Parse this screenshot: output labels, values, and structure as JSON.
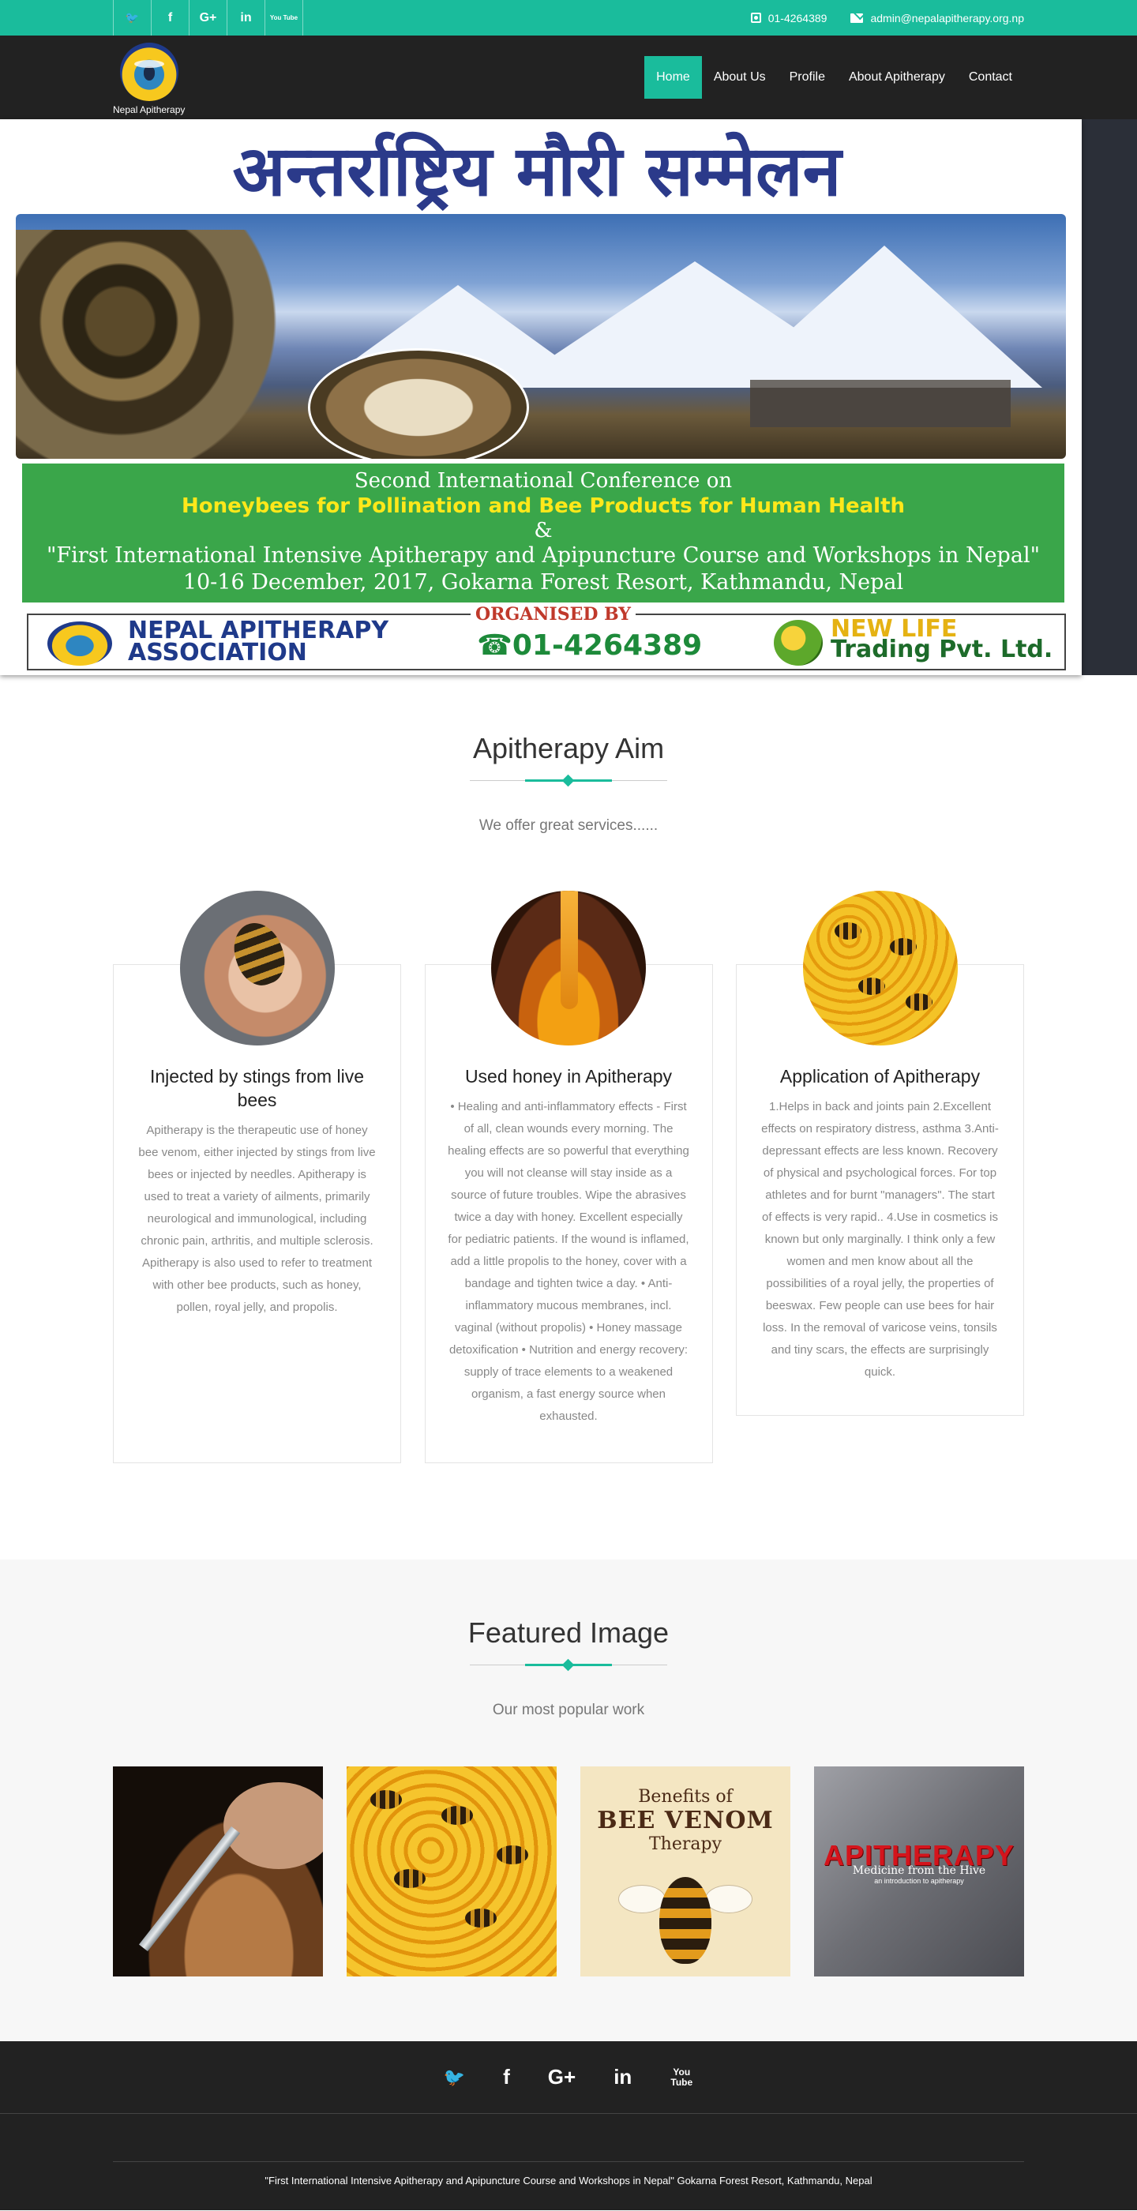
{
  "topbar": {
    "social": [
      {
        "icon": "twitter-icon",
        "glyph": "🐦"
      },
      {
        "icon": "facebook-icon",
        "glyph": "f"
      },
      {
        "icon": "google-plus-icon",
        "glyph": "G+"
      },
      {
        "icon": "linkedin-icon",
        "glyph": "in"
      },
      {
        "icon": "youtube-icon",
        "glyph": "You Tube"
      }
    ],
    "phone": "01-4264389",
    "email": "admin@nepalapitherapy.org.np"
  },
  "nav": {
    "brand": "Nepal Apitherapy",
    "items": [
      "Home",
      "About Us",
      "Profile",
      "About Apitherapy",
      "Contact"
    ],
    "active": "Home"
  },
  "banner": {
    "title": "अन्तर्राष्ट्रिय मौरी सम्मेलन",
    "line1": "Second International Conference on",
    "line2": "Honeybees for Pollination and Bee Products for Human Health",
    "line3": "&",
    "line4": "\"First International Intensive Apitherapy and Apipuncture Course and Workshops in Nepal\"",
    "line5": "10-16 December, 2017, Gokarna Forest Resort, Kathmandu, Nepal",
    "organised_by": "ORGANISED BY",
    "org_name_1": "NEPAL APITHERAPY",
    "org_name_2": "ASSOCIATION",
    "org_phone": "☎01-4264389",
    "partner_1": "NEW LIFE",
    "partner_2": "Trading Pvt. Ltd.",
    "partner_logo_text": "NEW LIFE"
  },
  "aim": {
    "title": "Apitherapy Aim",
    "subtitle": "We offer great services......",
    "cards": [
      {
        "title": "Injected by stings from live bees",
        "text": "Apitherapy is the therapeutic use of honey bee venom, either injected by stings from live bees or injected by needles. Apitherapy is used to treat a variety of ailments, primarily neurological and immunological, including chronic pain, arthritis, and multiple sclerosis. Apitherapy is also used to refer to treatment with other bee products, such as honey, pollen, royal jelly, and propolis."
      },
      {
        "title": "Used honey in Apitherapy",
        "text": "• Healing and anti-inflammatory effects - First of all, clean wounds every morning. The healing effects are so powerful that everything you will not cleanse will stay inside as a source of future troubles. Wipe the abrasives twice a day with honey. Excellent especially for pediatric patients. If the wound is inflamed, add a little propolis to the honey, cover with a bandage and tighten twice a day. • Anti-inflammatory mucous membranes, incl. vaginal (without propolis) • Honey massage detoxification • Nutrition and energy recovery: supply of trace elements to a weakened organism, a fast energy source when exhausted."
      },
      {
        "title": "Application of Apitherapy",
        "text": "1.Helps in back and joints pain 2.Excellent effects on respiratory distress, asthma 3.Anti-depressant effects are less known. Recovery of physical and psychological forces. For top athletes and for burnt \"managers\". The start of effects is very rapid.. 4.Use in cosmetics is known but only marginally. I think only a few women and men know about all the possibilities of a royal jelly, the properties of beeswax. Few people can use bees for hair loss. In the removal of varicose veins, tonsils and tiny scars, the effects are surprisingly quick."
      }
    ]
  },
  "featured": {
    "title": "Featured Image",
    "subtitle": "Our most popular work",
    "venom": {
      "a": "Benefits of",
      "b": "BEE VENOM",
      "c": "Therapy"
    },
    "apitherapy": {
      "h": "APITHERAPY",
      "s1": "Medicine from the Hive",
      "s2": "an introduction to apitherapy"
    }
  },
  "footer": {
    "social": [
      {
        "icon": "twitter-icon",
        "glyph": "🐦"
      },
      {
        "icon": "facebook-icon",
        "glyph": "f"
      },
      {
        "icon": "google-plus-icon",
        "glyph": "G+"
      },
      {
        "icon": "linkedin-icon",
        "glyph": "in"
      },
      {
        "icon": "youtube-icon",
        "glyph": "You Tube"
      }
    ],
    "text": "\"First International Intensive Apitherapy and Apipuncture Course and Workshops in Nepal\" Gokarna Forest Resort, Kathmandu, Nepal"
  },
  "colors": {
    "accent": "#1abc9c",
    "dark": "#222222",
    "poster_green": "#3aa64a"
  }
}
